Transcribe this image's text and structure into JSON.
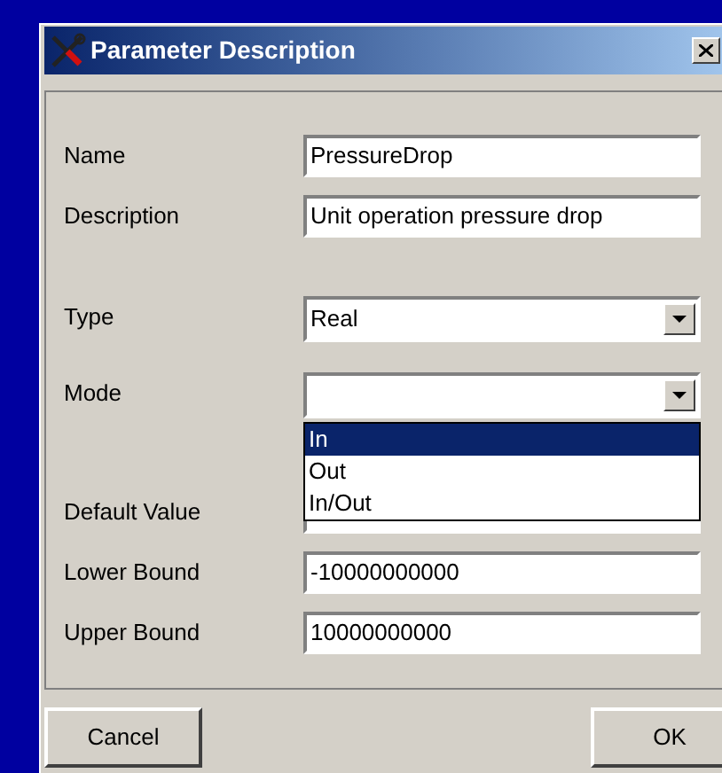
{
  "window": {
    "title": "Parameter Description"
  },
  "fields": [
    {
      "kind": "text",
      "label": "Name",
      "value": "PressureDrop"
    },
    {
      "kind": "text",
      "label": "Description",
      "value": "Unit operation pressure drop"
    },
    {
      "kind": "gap"
    },
    {
      "kind": "combo",
      "label": "Type",
      "value": "Real"
    },
    {
      "kind": "combo",
      "label": "Mode",
      "open": true,
      "options": [
        {
          "label": "In",
          "selected": true
        },
        {
          "label": "Out",
          "selected": false
        },
        {
          "label": "In/Out",
          "selected": false
        }
      ]
    },
    {
      "kind": "text",
      "label": "Default Value"
    },
    {
      "kind": "text",
      "label": "Lower Bound",
      "value": "-10000000000"
    },
    {
      "kind": "text",
      "label": "Upper Bound",
      "value": "10000000000"
    }
  ],
  "buttons": [
    "Cancel",
    "OK"
  ]
}
